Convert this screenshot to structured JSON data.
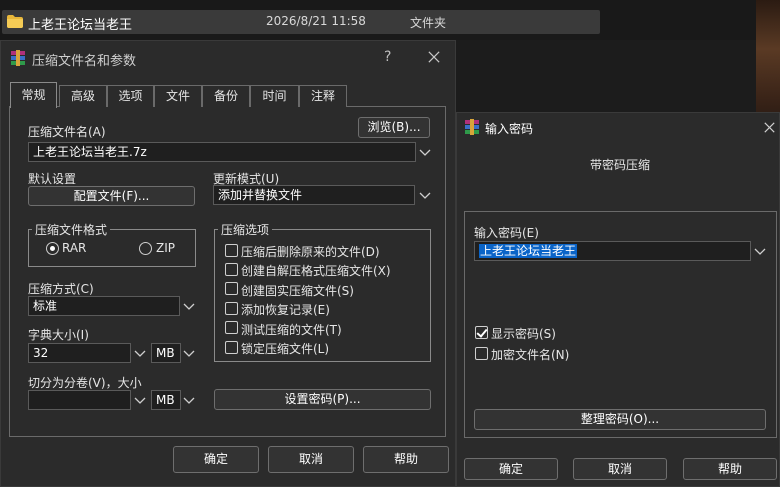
{
  "explorer": {
    "file_name": "上老王论坛当老王",
    "file_date": "2026/8/21 11:58",
    "file_type": "文件夹"
  },
  "main_dialog": {
    "title": "压缩文件名和参数",
    "help": "?",
    "tabs": [
      {
        "label": "常规"
      },
      {
        "label": "高级"
      },
      {
        "label": "选项"
      },
      {
        "label": "文件"
      },
      {
        "label": "备份"
      },
      {
        "label": "时间"
      },
      {
        "label": "注释"
      }
    ],
    "archive_name_label": "压缩文件名(A)",
    "browse_button": "浏览(B)...",
    "archive_name_value": "上老王论坛当老王.7z",
    "default_settings_label": "默认设置",
    "profiles_button": "配置文件(F)...",
    "update_mode_label": "更新模式(U)",
    "update_mode_value": "添加并替换文件",
    "format_group": "压缩文件格式",
    "format_rar": "RAR",
    "format_zip": "ZIP",
    "method_label": "压缩方式(C)",
    "method_value": "标准",
    "dict_label": "字典大小(I)",
    "dict_value": "32",
    "dict_unit": "MB",
    "split_label": "切分为分卷(V)，大小",
    "split_value": "",
    "split_unit": "MB",
    "options_group": "压缩选项",
    "options": [
      {
        "label": "压缩后删除原来的文件(D)",
        "checked": false
      },
      {
        "label": "创建自解压格式压缩文件(X)",
        "checked": false
      },
      {
        "label": "创建固实压缩文件(S)",
        "checked": false
      },
      {
        "label": "添加恢复记录(E)",
        "checked": false
      },
      {
        "label": "测试压缩的文件(T)",
        "checked": false
      },
      {
        "label": "锁定压缩文件(L)",
        "checked": false
      }
    ],
    "set_password_button": "设置密码(P)...",
    "ok": "确定",
    "cancel": "取消",
    "help_button": "帮助"
  },
  "password_dialog": {
    "title": "输入密码",
    "heading": "带密码压缩",
    "password_label": "输入密码(E)",
    "password_value": "上老王论坛当老王",
    "show_password": "显示密码(S)",
    "encrypt_names": "加密文件名(N)",
    "organize_button": "整理密码(O)...",
    "ok": "确定",
    "cancel": "取消",
    "help_button": "帮助"
  }
}
